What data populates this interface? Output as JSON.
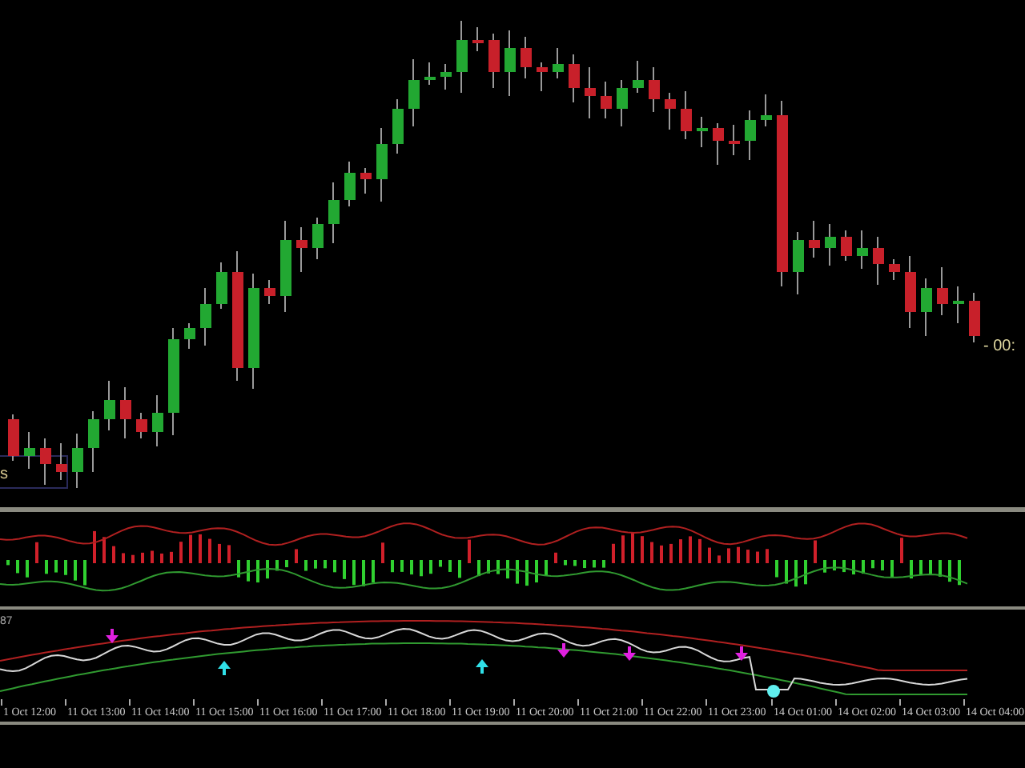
{
  "main_chart": {
    "label_box": "s",
    "countdown": "- 00:"
  },
  "bottom_pane": {
    "value_label": "87"
  },
  "time_axis": {
    "labels": [
      "1 Oct 12:00",
      "11 Oct 13:00",
      "11 Oct 14:00",
      "11 Oct 15:00",
      "11 Oct 16:00",
      "11 Oct 17:00",
      "11 Oct 18:00",
      "11 Oct 19:00",
      "11 Oct 20:00",
      "11 Oct 21:00",
      "11 Oct 22:00",
      "11 Oct 23:00",
      "14 Oct 01:00",
      "14 Oct 02:00",
      "14 Oct 03:00",
      "14 Oct 04:00"
    ]
  }
}
